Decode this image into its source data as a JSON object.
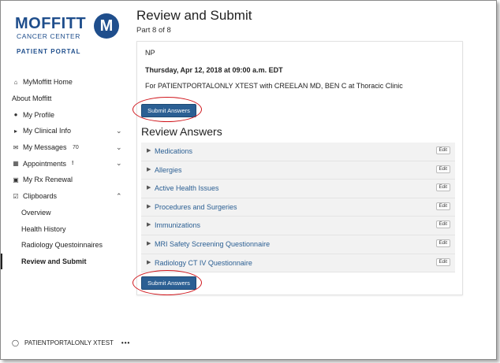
{
  "logo": {
    "word": "MOFFITT",
    "sub": "CANCER CENTER",
    "portal": "PATIENT PORTAL",
    "mark": "M"
  },
  "sidebar": {
    "items": [
      {
        "label": "MyMoffitt Home",
        "icon": "home-icon"
      },
      {
        "label": "About Moffitt",
        "icon": ""
      },
      {
        "label": "My Profile",
        "icon": "profile-icon"
      },
      {
        "label": "My Clinical Info",
        "icon": "clinical-icon"
      },
      {
        "label": "My Messages",
        "icon": "envelope-icon",
        "badge": "70"
      },
      {
        "label": "Appointments",
        "icon": "calendar-icon",
        "badge": "!"
      },
      {
        "label": "My Rx Renewal",
        "icon": "rx-icon"
      },
      {
        "label": "Clipboards",
        "icon": "clipboard-icon"
      }
    ],
    "subitems": [
      {
        "label": "Overview"
      },
      {
        "label": "Health History"
      },
      {
        "label": "Radiology Questoinnaires"
      },
      {
        "label": "Review and Submit"
      }
    ],
    "user": "PATIENTPORTALONLY XTEST",
    "more": "•••"
  },
  "main": {
    "title": "Review and Submit",
    "subtitle": "Part 8 of 8",
    "card": {
      "provider_type": "NP",
      "date": "Thursday, Apr 12, 2018 at 09:00 a.m. EDT",
      "for_line": "For PATIENTPORTALONLY XTEST with CREELAN MD, BEN C at Thoracic Clinic",
      "submit_label": "Submit Answers",
      "review_heading": "Review Answers",
      "sections": [
        {
          "label": "Medications",
          "edit": "Edit"
        },
        {
          "label": "Allergies",
          "edit": "Edit"
        },
        {
          "label": "Active Health Issues",
          "edit": "Edit"
        },
        {
          "label": "Procedures and Surgeries",
          "edit": "Edit"
        },
        {
          "label": "Immunizations",
          "edit": "Edit"
        },
        {
          "label": "MRI Safety Screening Questionnaire",
          "edit": "Edit"
        },
        {
          "label": "Radiology CT IV Questionnaire",
          "edit": "Edit"
        }
      ]
    }
  },
  "colors": {
    "brand": "#1f4e8c",
    "button": "#2b5f93",
    "highlight_ring": "#d0161c"
  }
}
